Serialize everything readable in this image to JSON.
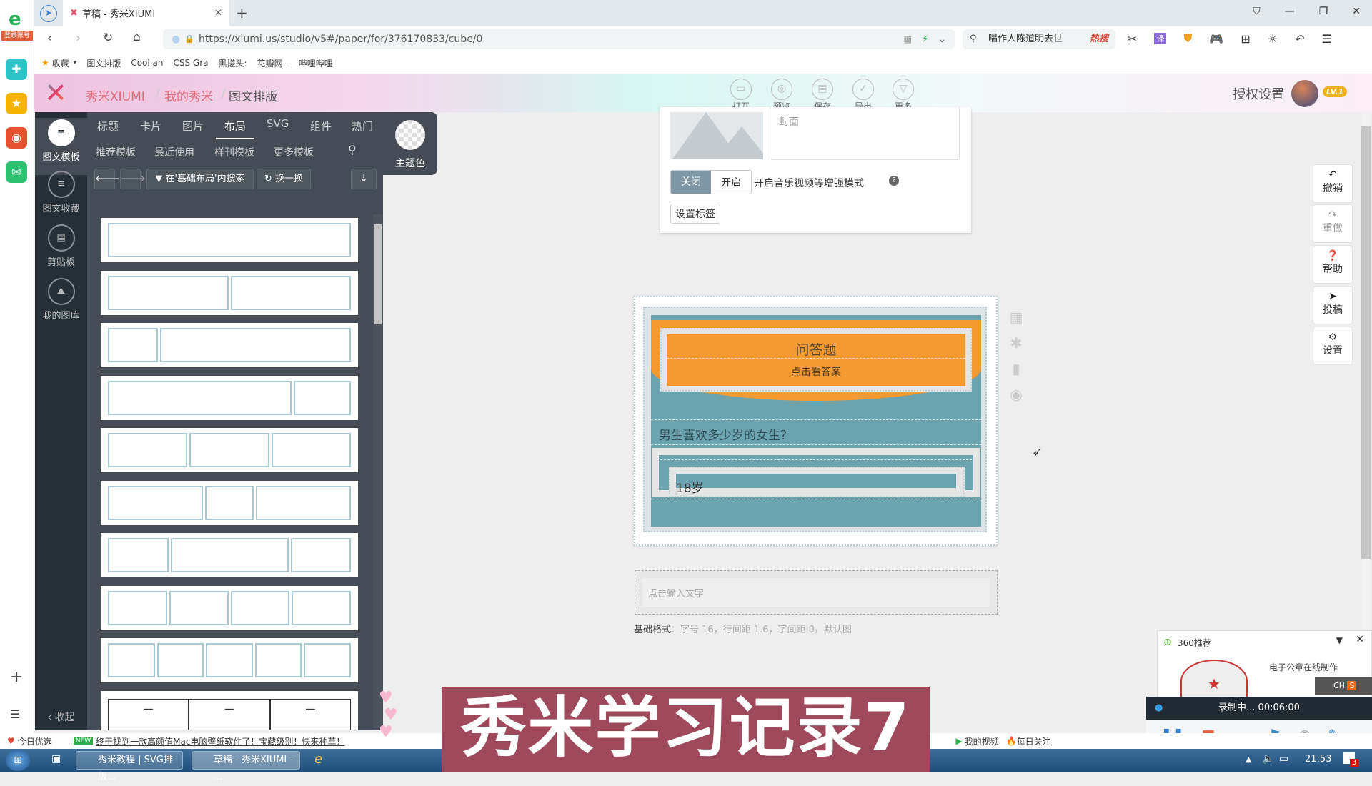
{
  "browser": {
    "login_badge": "登录账号",
    "tab_title": "草稿 - 秀米XIUMI",
    "url": "https://xiumi.us/studio/v5#/paper/for/376170833/cube/0",
    "search_hint": "唱作人陈道明去世",
    "hot_badge": "热搜",
    "bookmarks": [
      "收藏",
      "图文排版",
      "Cool an",
      "CSS Gra",
      "黑搓头:",
      "花瓣网 -",
      "哔哩哔哩"
    ]
  },
  "app": {
    "breadcrumb": [
      "秀米XIUMI",
      "我的秀米",
      "图文排版"
    ],
    "tools": [
      "打开",
      "预览",
      "保存",
      "导出",
      "更多"
    ],
    "auth_settings": "授权设置",
    "level_badge": "LV.1"
  },
  "left_panel": {
    "side_items": [
      "图文模板",
      "图文收藏",
      "剪贴板",
      "我的图库"
    ],
    "collapse": "收起",
    "tabs": [
      "标题",
      "卡片",
      "图片",
      "布局",
      "SVG",
      "组件",
      "热门"
    ],
    "active_tab": "布局",
    "subtabs": [
      "推荐模板",
      "最近使用",
      "样刊模板",
      "更多模板"
    ],
    "theme_color": "主题色",
    "search_in": "在'基础布局'内搜索",
    "shuffle": "换一换",
    "table_cells": [
      "一",
      "一",
      "一"
    ]
  },
  "cover_card": {
    "desc_tail": "封面",
    "toggle_off": "关闭",
    "toggle_on": "开启",
    "enhanced_mode": "开启音乐视频等增强模式",
    "set_tags": "设置标签"
  },
  "editor": {
    "qa_title": "问答题",
    "qa_sub": "点击看答案",
    "question": "男生喜欢多少岁的女生？",
    "answer": "18岁",
    "text_placeholder": "点击输入文字",
    "base_format_label": "基础格式",
    "base_format_value": "：字号 16，行间距 1.6，字间距 0，默认图"
  },
  "right_tools": [
    "撤销",
    "重做",
    "帮助",
    "投稿",
    "设置"
  ],
  "popup_360": {
    "title": "360推荐",
    "item": "电子公章在线制作",
    "ime": "CH"
  },
  "recorder": {
    "status": "录制中... 00:06:00"
  },
  "overlay_title": "秀米学习记录7",
  "statusbar": {
    "today": "今日优选",
    "new": "NEW",
    "news": "终于找到一款高颜值Mac电脑壁纸软件了！宝藏级别！快来种草！",
    "my_video": "我的视频",
    "daily": "每日关注"
  },
  "taskbar": {
    "items": [
      "秀米教程 | SVG排版...",
      "草稿 - 秀米XIUMI - ..."
    ],
    "clock": "21:53",
    "notif_count": "3"
  },
  "colors": {
    "teal": "#6ba3ae",
    "orange": "#f59a30",
    "dark_panel": "#454c55",
    "overlay": "#9e4a5c"
  }
}
